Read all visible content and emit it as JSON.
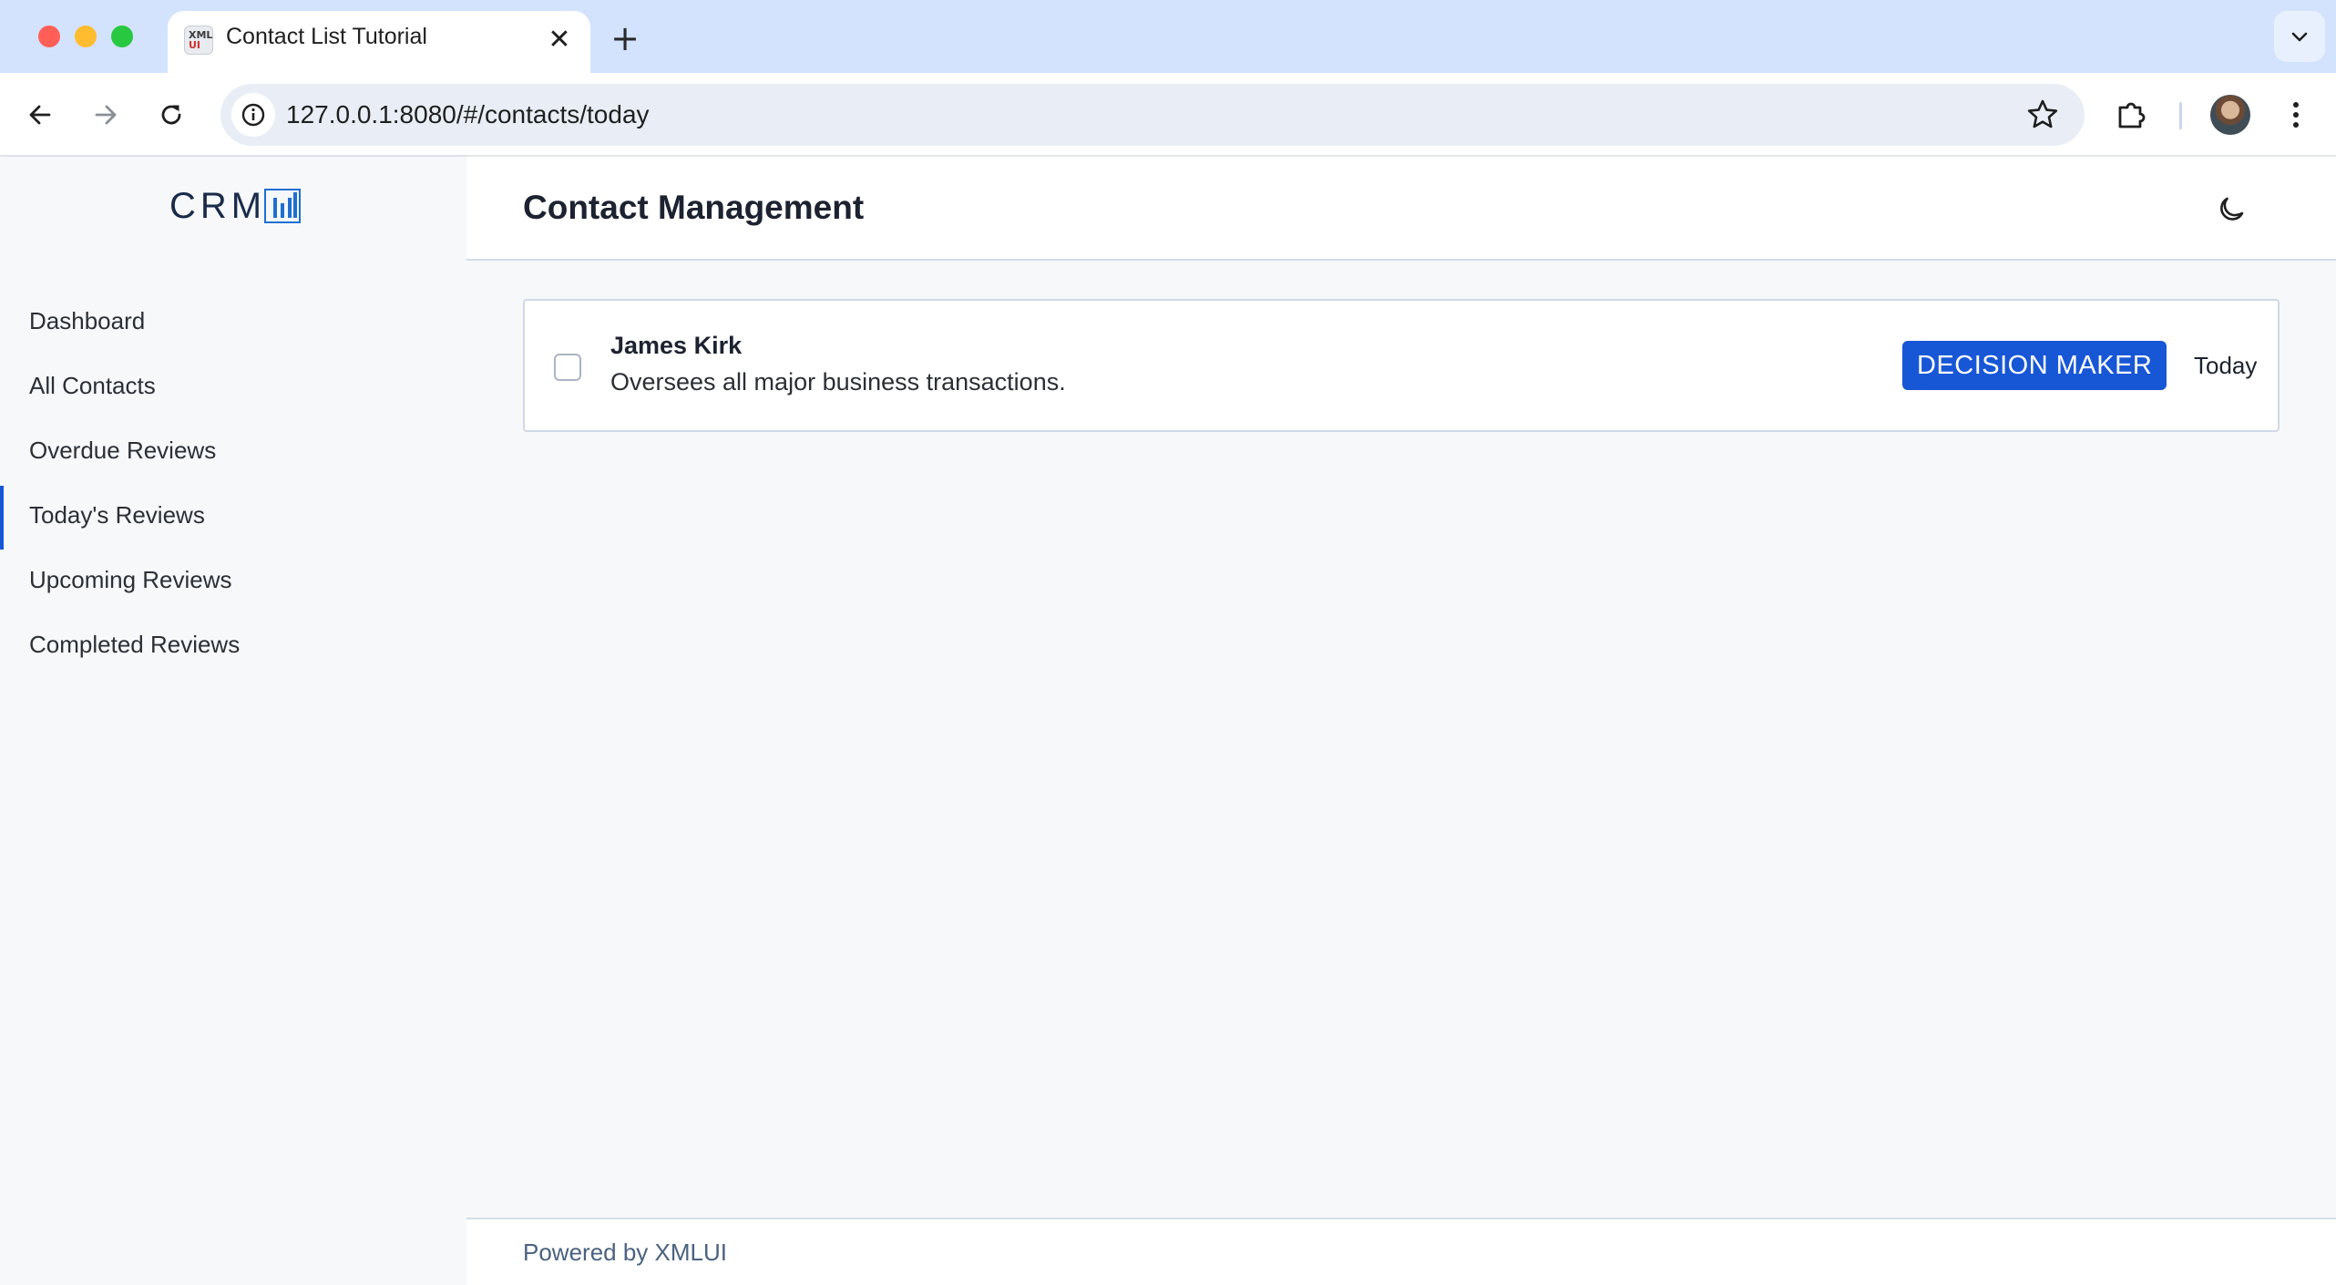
{
  "browser": {
    "tab_title": "Contact List Tutorial",
    "favicon_text_top": "XML",
    "favicon_text_bottom": "UI",
    "tab_close": "✕",
    "new_tab": "+",
    "url": "127.0.0.1:8080/#/contacts/today"
  },
  "sidebar": {
    "logo_text": "CRM",
    "items": [
      {
        "label": "Dashboard",
        "active": false
      },
      {
        "label": "All Contacts",
        "active": false
      },
      {
        "label": "Overdue Reviews",
        "active": false
      },
      {
        "label": "Today's Reviews",
        "active": true
      },
      {
        "label": "Upcoming Reviews",
        "active": false
      },
      {
        "label": "Completed Reviews",
        "active": false
      }
    ]
  },
  "header": {
    "title": "Contact Management"
  },
  "contacts": [
    {
      "name": "James Kirk",
      "description": "Oversees all major business transactions.",
      "badge": "DECISION MAKER",
      "due": "Today",
      "checked": false
    }
  ],
  "footer": {
    "text": "Powered by XMLUI"
  },
  "colors": {
    "accent": "#1757d6",
    "tabbar": "#d3e3fd",
    "sidebar_bg": "#f6f8fa"
  },
  "icons": {
    "back": "arrow-left-icon",
    "forward": "arrow-right-icon",
    "reload": "reload-icon",
    "info": "info-icon",
    "star": "star-icon",
    "extensions": "puzzle-icon",
    "menu": "kebab-menu-icon",
    "theme": "moon-icon",
    "tabs": "chevron-down-icon"
  }
}
